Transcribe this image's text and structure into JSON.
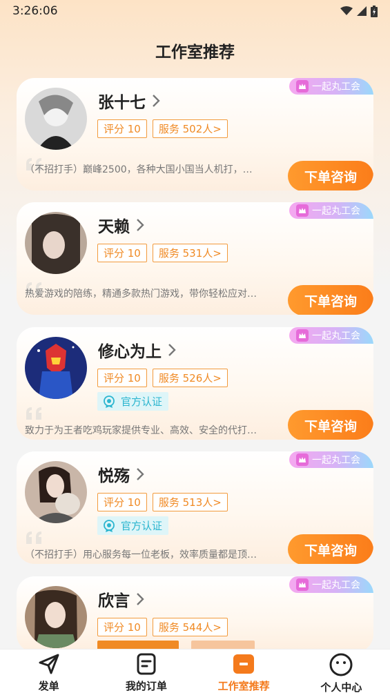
{
  "status": {
    "time": "3:26:06"
  },
  "page_title": "工作室推荐",
  "union_label": "一起丸工会",
  "consult_label": "下单咨询",
  "cert_label": "官方认证",
  "cards": [
    {
      "name": "张十七",
      "rating": "评分 10",
      "service": "服务 502人>",
      "certified": false,
      "desc": "（不招打手）巅峰2500，各种大国小国当人机打，…"
    },
    {
      "name": "天赖",
      "rating": "评分 10",
      "service": "服务 531人>",
      "certified": false,
      "desc": "热爱游戏的陪练，精通多款热门游戏，带你轻松应对…"
    },
    {
      "name": "修心为上",
      "rating": "评分 10",
      "service": "服务 526人>",
      "certified": true,
      "desc": "致力于为王者吃鸡玩家提供专业、高效、安全的代打…"
    },
    {
      "name": "悦殇",
      "rating": "评分 10",
      "service": "服务 513人>",
      "certified": true,
      "desc": "（不招打手）用心服务每一位老板，效率质量都是顶…"
    },
    {
      "name": "欣言",
      "rating": "评分 10",
      "service": "服务 544人>",
      "certified": false,
      "desc": ""
    }
  ],
  "tabs": [
    {
      "label": "发单",
      "icon": "send-icon"
    },
    {
      "label": "我的订单",
      "icon": "order-icon"
    },
    {
      "label": "工作室推荐",
      "icon": "studio-icon",
      "active": true
    },
    {
      "label": "个人中心",
      "icon": "profile-icon"
    }
  ],
  "colors": {
    "accent": "#f47a1c",
    "tag_border": "#f29a3c",
    "cert": "#2bb5cf"
  }
}
